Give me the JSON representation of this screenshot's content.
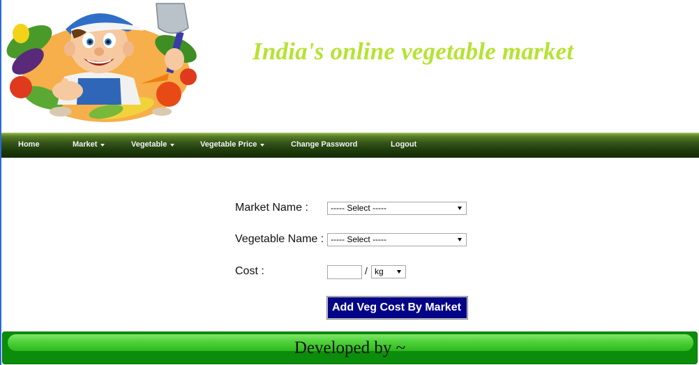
{
  "header": {
    "title": "India's online vegetable market",
    "title_color": "#b5e332"
  },
  "nav": {
    "items": [
      {
        "label": "Home",
        "has_dropdown": false
      },
      {
        "label": "Market",
        "has_dropdown": true
      },
      {
        "label": "Vegetable",
        "has_dropdown": true
      },
      {
        "label": "Vegetable Price",
        "has_dropdown": true
      },
      {
        "label": "Change Password",
        "has_dropdown": false
      },
      {
        "label": "Logout",
        "has_dropdown": false
      }
    ]
  },
  "form": {
    "market_label": "Market Name :",
    "market_value": "----- Select -----",
    "vegetable_label": "Vegetable Name :",
    "vegetable_value": "----- Select -----",
    "cost_label": "Cost :",
    "cost_value": "",
    "separator": "/",
    "unit_value": "kg",
    "submit_label": "Add Veg Cost By Market"
  },
  "footer": {
    "text": "Developed by ~"
  },
  "colors": {
    "nav_bg": "#1e3b0b",
    "button_bg": "#040488",
    "footer_bg": "#0b8d0b"
  }
}
